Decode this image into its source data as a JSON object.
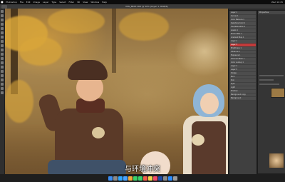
{
  "menubar": {
    "items": [
      "Photoshop",
      "File",
      "Edit",
      "Image",
      "Layer",
      "Type",
      "Select",
      "Filter",
      "3D",
      "View",
      "Window",
      "Help"
    ],
    "status": "Wed 10:45"
  },
  "options_bar": {
    "document_title": "IMG_8823.CR2 @ 50% (Layer 1, RGB/8)"
  },
  "layers_panel": {
    "layers": [
      "Layer 1",
      "Curves 1",
      "Color Balance 1",
      "Selective Color 1",
      "Hue/Saturation 1",
      "Levels 1",
      "Photo Filter 1",
      "Gradient Map 1",
      "Layer 2",
      "Layer 3",
      "Brightness 1",
      "Vibrance 1",
      "Exposure 1",
      "Channel Mixer 1",
      "Color Lookup 1",
      "Layer 4",
      "Layer 5",
      "Dodge",
      "Burn",
      "Skin",
      "Eyes",
      "Light",
      "Shadow",
      "Background copy",
      "Background"
    ],
    "selected_index": 9
  },
  "properties_panel": {
    "header": "Properties"
  },
  "subtitle": {
    "text": "与环境冲突"
  },
  "colors": {
    "menubar_bg": "#0c0c0c",
    "panel_bg": "#2b2b2b",
    "selected_layer": "#c23a3a"
  },
  "dock": {
    "icons": [
      "finder-icon",
      "launchpad-icon",
      "safari-icon",
      "mail-icon",
      "photos-icon",
      "messages-icon",
      "facetime-icon",
      "calendar-icon",
      "notes-icon",
      "music-icon",
      "photoshop-icon",
      "settings-icon",
      "app-store-icon",
      "trash-icon"
    ]
  }
}
